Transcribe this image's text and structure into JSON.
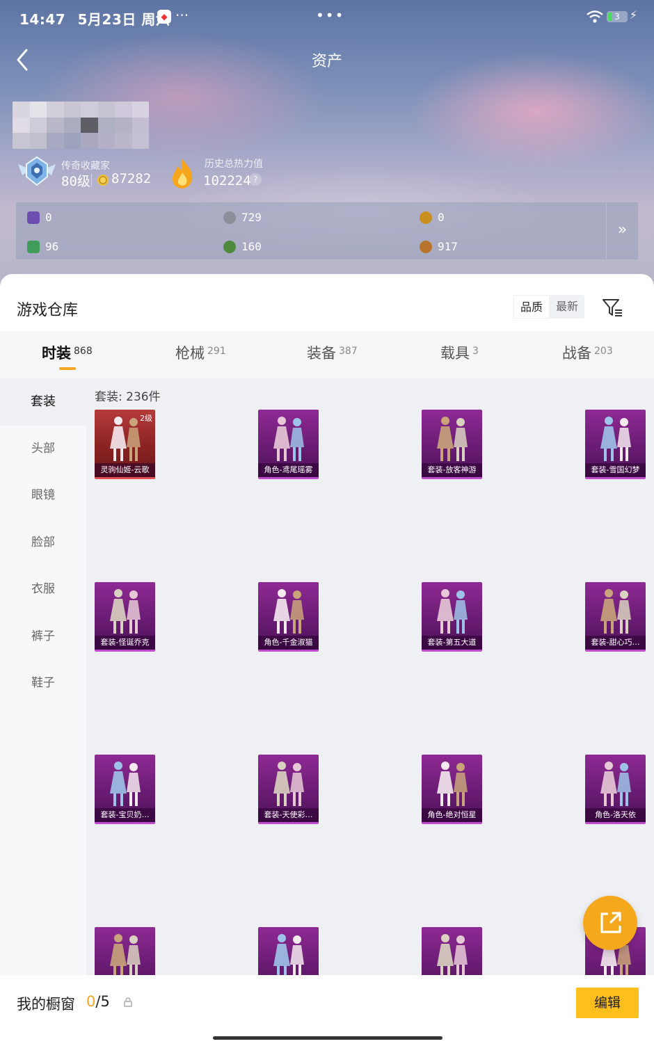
{
  "status_bar": {
    "time": "14:47",
    "date": "5月23日 周六",
    "more": "···",
    "center_dots": "•••",
    "battery": "3"
  },
  "header": {
    "title": "资产"
  },
  "profile": {
    "rank_label": "传奇收藏家",
    "level": "80级",
    "coins": "87282",
    "heat_label": "历史总热力值",
    "heat_value": "102224",
    "help": "?"
  },
  "currencies": [
    {
      "value": "0",
      "icon": "purple-card-icon",
      "color": "#6c4fb0"
    },
    {
      "value": "729",
      "icon": "silver-coin-icon",
      "color": "#8a8f99"
    },
    {
      "value": "0",
      "icon": "gold-token-icon",
      "color": "#c9901f"
    },
    {
      "value": "96",
      "icon": "green-card-icon",
      "color": "#3f9c5a"
    },
    {
      "value": "160",
      "icon": "green-orb-icon",
      "color": "#4e8a3c"
    },
    {
      "value": "917",
      "icon": "bronze-orb-icon",
      "color": "#b8742a"
    }
  ],
  "expand": "»",
  "warehouse": {
    "title": "游戏仓库",
    "sort_options": [
      "品质",
      "最新"
    ],
    "tabs": [
      {
        "label": "时装",
        "count": "868"
      },
      {
        "label": "枪械",
        "count": "291"
      },
      {
        "label": "装备",
        "count": "387"
      },
      {
        "label": "载具",
        "count": "3"
      },
      {
        "label": "战备",
        "count": "203"
      }
    ],
    "categories": [
      "套装",
      "头部",
      "眼镜",
      "脸部",
      "衣服",
      "裤子",
      "鞋子"
    ],
    "grid_header": "套装: 236件",
    "items": [
      {
        "name": "灵驹仙姬-云歌",
        "level": "2级",
        "rarity": "red"
      },
      {
        "name": "角色-鸢尾瑶雾",
        "level": "",
        "rarity": "purple"
      },
      {
        "name": "套装-放客神游",
        "level": "",
        "rarity": "purple"
      },
      {
        "name": "套装-雪国幻梦",
        "level": "",
        "rarity": "purple"
      },
      {
        "name": "套装-怪诞乔克",
        "level": "",
        "rarity": "purple"
      },
      {
        "name": "角色-千金淑猫",
        "level": "",
        "rarity": "purple"
      },
      {
        "name": "套装-第五大道",
        "level": "",
        "rarity": "purple"
      },
      {
        "name": "套装-甜心巧…",
        "level": "",
        "rarity": "purple"
      },
      {
        "name": "套装-宝贝奶…",
        "level": "",
        "rarity": "purple"
      },
      {
        "name": "套装-天使彩…",
        "level": "",
        "rarity": "purple"
      },
      {
        "name": "角色-绝对恒星",
        "level": "",
        "rarity": "purple"
      },
      {
        "name": "角色-洛天依",
        "level": "",
        "rarity": "purple"
      },
      {
        "name": "",
        "level": "",
        "rarity": "purple"
      },
      {
        "name": "",
        "level": "",
        "rarity": "purple"
      },
      {
        "name": "",
        "level": "",
        "rarity": "purple"
      },
      {
        "name": "",
        "level": "",
        "rarity": "purple"
      }
    ]
  },
  "showcase": {
    "label": "我的橱窗",
    "used": "0",
    "total": "/5",
    "edit": "编辑"
  },
  "colors": {
    "accent": "#f5a623",
    "button": "#fcbf1e",
    "item_purple": "#7a2183",
    "item_red": "#9a2b2b"
  }
}
